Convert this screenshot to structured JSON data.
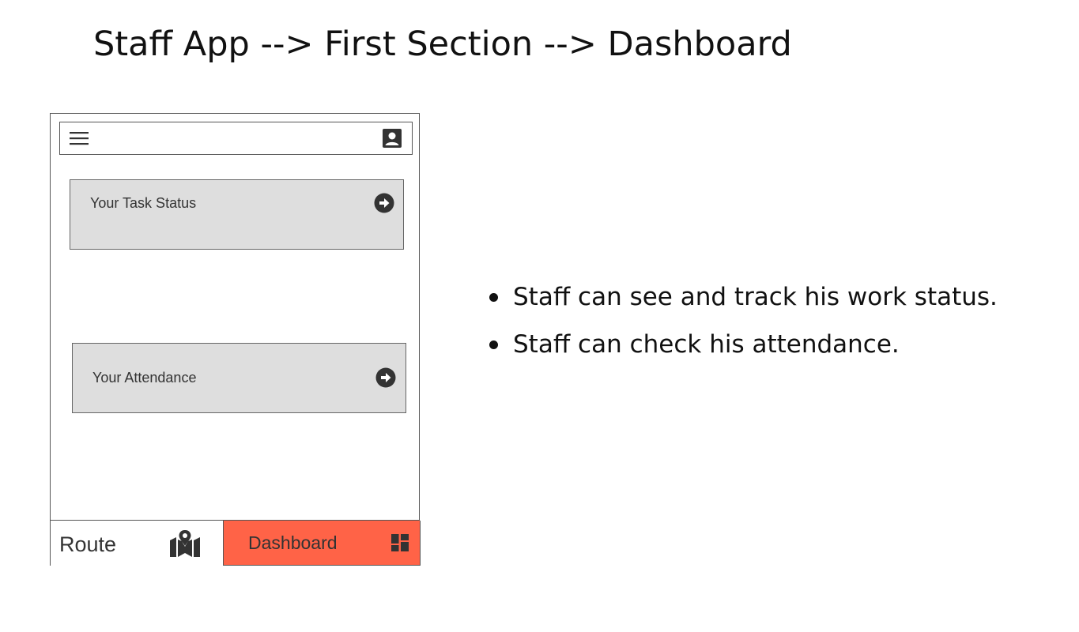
{
  "page": {
    "title": "Staff App --> First Section --> Dashboard"
  },
  "topbar": {
    "menu_icon": "hamburger-menu-icon",
    "profile_icon": "account-box-icon"
  },
  "cards": [
    {
      "label": "Your Task Status",
      "icon": "arrow-right-circle-icon"
    },
    {
      "label": "Your Attendance",
      "icon": "arrow-right-circle-icon"
    }
  ],
  "bottom_nav": {
    "route": {
      "label": "Route",
      "icon": "map-icon"
    },
    "dashboard": {
      "label": "Dashboard",
      "icon": "dashboard-icon",
      "active": true,
      "color": "#ff6347"
    }
  },
  "notes": [
    "Staff can see and track his work status.",
    "Staff can check his attendance."
  ],
  "colors": {
    "accent": "#ff6347",
    "card_bg": "#dedede",
    "border": "#555555",
    "icon": "#333333"
  }
}
